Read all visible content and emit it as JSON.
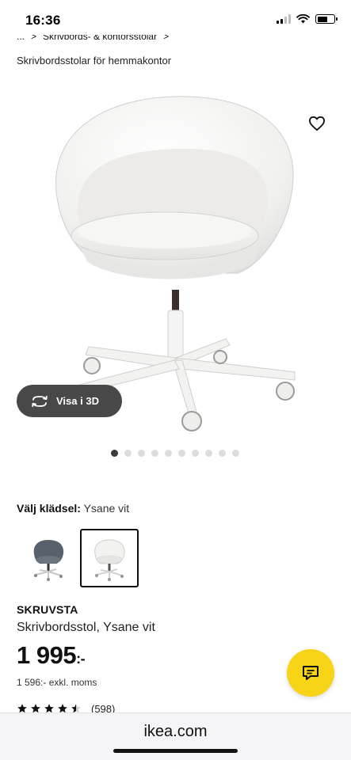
{
  "status_bar": {
    "time": "16:36",
    "signal_icon": "cellular-signal-icon",
    "wifi_icon": "wifi-icon",
    "battery_icon": "battery-icon",
    "battery_level": 0.6
  },
  "breadcrumb": {
    "ellipsis": "...",
    "separator": ">",
    "parent": "Skrivbords- & kontorsstolar",
    "current": "Skrivbordsstolar för hemmakontor"
  },
  "product_image": {
    "icon": "office-chair-image",
    "favorite_icon": "heart-outline-icon"
  },
  "view_3d": {
    "icon": "rotate-3d-icon",
    "label": "Visa i 3D"
  },
  "carousel": {
    "total": 10,
    "active": 0
  },
  "upholstery": {
    "label": "Välj klädsel:",
    "value": "Ysane vit",
    "options": [
      {
        "name": "grey-chair-swatch",
        "color": "#56616b",
        "selected": false
      },
      {
        "name": "white-chair-swatch",
        "color": "#f2f2f0",
        "selected": true
      }
    ]
  },
  "product": {
    "name": "SKRUVSTA",
    "description": "Skrivbordsstol, Ysane vit",
    "price": "1 995",
    "price_suffix": ":-",
    "price_excl": "1 596:- exkl. moms",
    "rating": 4.5,
    "review_count": "(598)"
  },
  "chat": {
    "icon": "chat-bubble-icon",
    "color": "#f7d417"
  },
  "browser": {
    "url": "ikea.com"
  }
}
